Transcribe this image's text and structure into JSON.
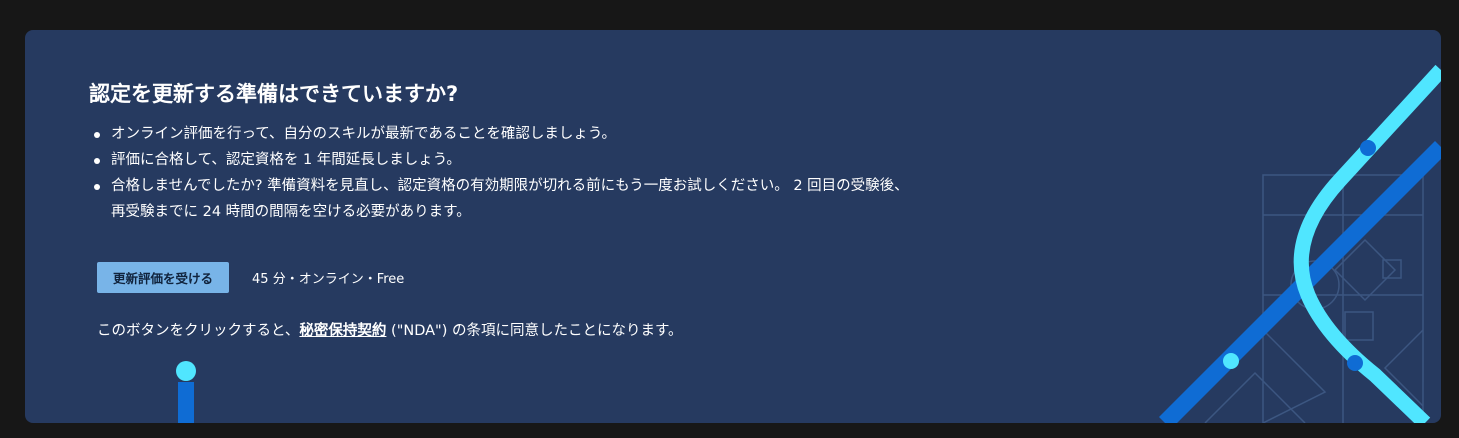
{
  "renewal": {
    "title": "認定を更新する準備はできていますか?",
    "bullets": [
      "オンライン評価を行って、自分のスキルが最新であることを確認しましょう。",
      "評価に合格して、認定資格を 1 年間延長しましょう。",
      "合格しませんでしたか? 準備資料を見直し、認定資格の有効期限が切れる前にもう一度お試しください。 2 回目の受験後、再受験までに 24 時間の間隔を空ける必要があります。"
    ],
    "button_label": "更新評価を受ける",
    "meta": "45 分・オンライン・Free",
    "nda_prefix": "このボタンをクリックすると、",
    "nda_link": "秘密保持契約",
    "nda_suffix": " (\"NDA\") の条項に同意したことになります。"
  },
  "colors": {
    "page_background": "#171717",
    "card_background": "#263a60",
    "button_background": "#78b4e8",
    "accent_light": "#50e6ff",
    "accent_blue": "#0f6cd4"
  }
}
